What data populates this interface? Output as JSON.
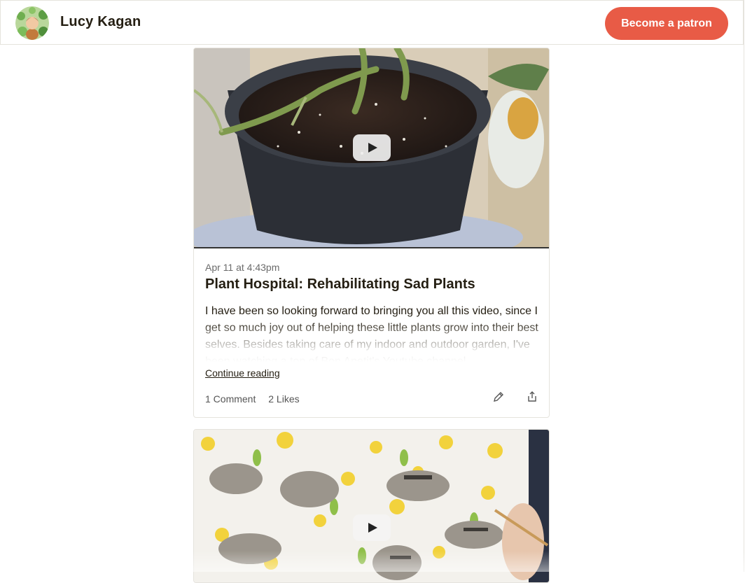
{
  "header": {
    "creator_name": "Lucy Kagan",
    "cta_label": "Become a patron",
    "accent_color": "#e85b46"
  },
  "posts": [
    {
      "date": "Apr 11 at 4:43pm",
      "title": "Plant Hospital: Rehabilitating Sad Plants",
      "excerpt": "I have been so looking forward to bringing you all this video, since I get so much joy out of helping these little plants grow into their best selves. Besides taking care of my indoor and outdoor garden, I've been watching a ton of Bon Apetit's Youtube channel",
      "continue_label": "Continue reading",
      "comments_label": "1 Comment",
      "likes_label": "2 Likes",
      "media_type": "video",
      "icons": [
        "play-icon",
        "pencil-icon",
        "share-icon"
      ]
    },
    {
      "media_type": "video",
      "icons": [
        "play-icon"
      ]
    }
  ]
}
